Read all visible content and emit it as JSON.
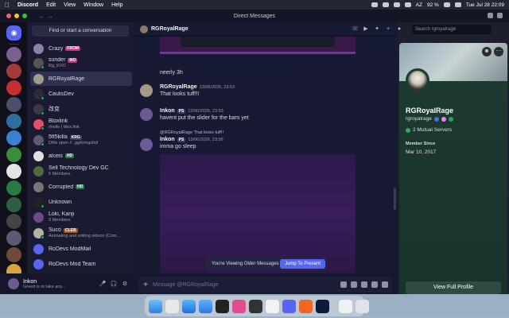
{
  "menubar": {
    "app": "Discord",
    "menus": [
      "Edit",
      "View",
      "Window",
      "Help"
    ],
    "battery": "92 %",
    "input_source": "AZ",
    "datetime": "Tue Jul 28  22:09"
  },
  "window": {
    "title": "Direct Messages"
  },
  "sidebar": {
    "search_button": "Find or start a conversation",
    "dms": [
      {
        "name": "Crazy",
        "tag": "FROM",
        "sub": ""
      },
      {
        "name": "sunder",
        "tag": "MO",
        "sub": "Rg_EVO"
      },
      {
        "name": "RGRoyalRage",
        "tag": "",
        "sub": ""
      },
      {
        "name": "CaulisDev",
        "tag": "",
        "sub": ""
      },
      {
        "name": "改变",
        "tag": "",
        "sub": ""
      },
      {
        "name": "Bloxlink",
        "tag": "",
        "sub": "/invite | blox.link"
      },
      {
        "name": "5ft5killa",
        "tag": "KRG",
        "sub": "DMs open // .gg/kriegsfall"
      },
      {
        "name": "alceis",
        "tag": "HD",
        "sub": ""
      },
      {
        "name": "Sell Technology Dev GC",
        "tag": "",
        "sub": "5 Members"
      },
      {
        "name": "Corrupted",
        "tag": "HD",
        "sub": ""
      },
      {
        "name": "Unknown",
        "tag": "",
        "sub": ""
      },
      {
        "name": "Loki, Kanji",
        "tag": "",
        "sub": "3 Members"
      },
      {
        "name": "Suco",
        "tag": "CLEB",
        "sub": "Animating and editing videos (Com..."
      },
      {
        "name": "RoDevs ModMail",
        "tag": "",
        "sub": ""
      },
      {
        "name": "RoDevs Mod Team",
        "tag": "",
        "sub": ""
      }
    ]
  },
  "user_panel": {
    "name": "Inkon",
    "status": "Greed is to take any..."
  },
  "chat": {
    "header_name": "RGRoyalRage",
    "messages": [
      {
        "author": "",
        "time": "",
        "text": "neerly 3h"
      },
      {
        "author": "RGRoyalRage",
        "time": "13/06/2026, 23:53",
        "text": "That looks tuff!!!"
      },
      {
        "author": "Inkon",
        "tag": "PS",
        "time": "13/06/2026, 23:53",
        "text": "havent put the slider for the bars yet"
      },
      {
        "author": "Inkon",
        "tag": "PS",
        "time": "13/06/2026, 23:56",
        "text": "imma go sleep",
        "reply": "@RGRoyalRage That looks tuff!!"
      }
    ],
    "older_notice": "You're Viewing Older Messages",
    "jump_button": "Jump To Present",
    "composer_placeholder": "Message @RGRoyalRage",
    "search_placeholder": "Search rgroyalrage"
  },
  "profile": {
    "display_name": "RGRoyalRage",
    "username": "rgroyalrage",
    "mutual": "2 Mutual Servers",
    "member_since_label": "Member Since",
    "member_since": "Mar 10, 2017",
    "view_full": "View Full Profile"
  },
  "colors": {
    "blurple": "#5865f2",
    "online": "#23a55a",
    "profile_bg": "#1e3b32"
  }
}
